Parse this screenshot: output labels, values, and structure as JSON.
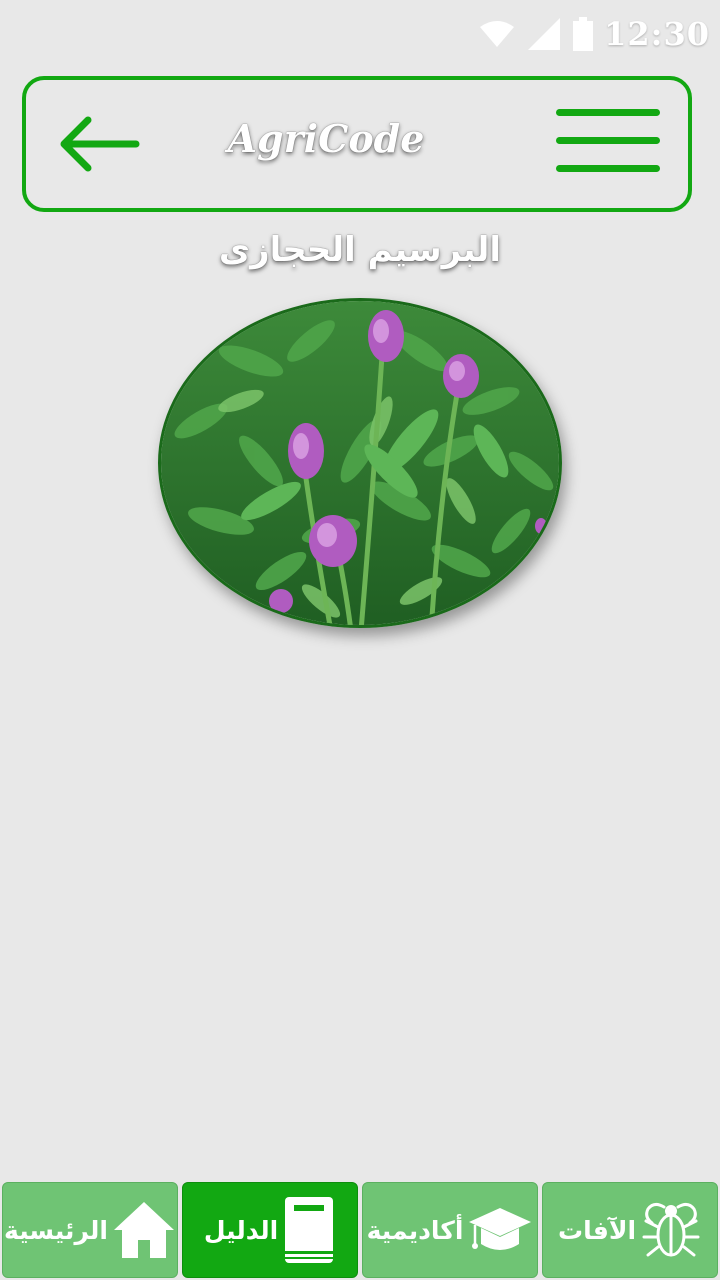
{
  "status_bar": {
    "time": "12:30",
    "icons": [
      "wifi-icon",
      "cell-signal-icon",
      "battery-icon"
    ]
  },
  "header": {
    "title": "AgriCode",
    "back_icon": "arrow-left-icon",
    "menu_icon": "hamburger-menu-icon"
  },
  "page": {
    "title": "البرسيم الحجازى",
    "image_subject": "alfalfa-plant"
  },
  "bottom_nav": {
    "items": [
      {
        "label": "الآفات",
        "icon": "bug-icon",
        "active": false
      },
      {
        "label": "أكاديمية",
        "icon": "graduation-cap-icon",
        "active": false
      },
      {
        "label": "الدليل",
        "icon": "book-icon",
        "active": true
      },
      {
        "label": "الرئيسية",
        "icon": "home-icon",
        "active": false
      }
    ]
  },
  "colors": {
    "accent": "#12a812",
    "tab_inactive": "#6fc474",
    "background": "#e8e8e8"
  }
}
